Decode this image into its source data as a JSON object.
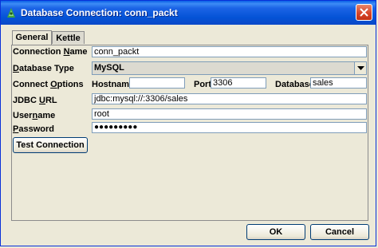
{
  "window": {
    "title": "Database Connection: conn_packt"
  },
  "tabs": [
    {
      "label": "General"
    },
    {
      "label": "Kettle"
    }
  ],
  "form": {
    "connection_name": {
      "label_pre": "Connection ",
      "label_u": "N",
      "label_post": "ame",
      "value": "conn_packt"
    },
    "database_type": {
      "label_u": "D",
      "label_post": "atabase Type",
      "value": "MySQL"
    },
    "connect_options": {
      "label_pre": "Connect ",
      "label_u": "O",
      "label_post": "ptions"
    },
    "hostname": {
      "label": "Hostname",
      "value": ""
    },
    "port": {
      "label": "Port",
      "value": "3306"
    },
    "database": {
      "label": "Database",
      "value": "sales"
    },
    "jdbc_url": {
      "label_pre": "JDBC ",
      "label_u": "U",
      "label_post": "RL",
      "value": "jdbc:mysql://:3306/sales"
    },
    "username": {
      "label_pre": "User",
      "label_u": "n",
      "label_post": "ame",
      "value": "root"
    },
    "password": {
      "label_u": "P",
      "label_post": "assword",
      "value": "●●●●●●●●●"
    }
  },
  "buttons": {
    "test_connection": "Test Connection",
    "ok": "OK",
    "cancel": "Cancel"
  },
  "colors": {
    "titlebar": "#0453d6",
    "close": "#d7452a",
    "panel_bg": "#ece9d8"
  }
}
